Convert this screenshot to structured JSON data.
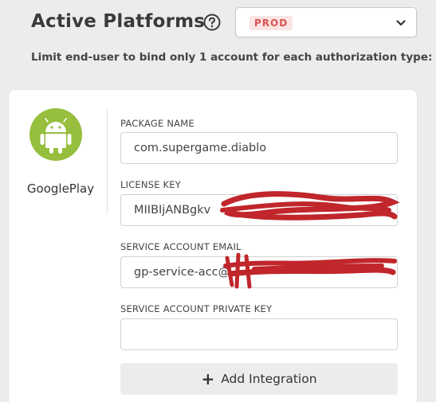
{
  "header": {
    "title": "Active Platforms",
    "help_icon": "help-circle-icon",
    "environment": {
      "selected": "PROD",
      "badge_bg": "#fbe4e4",
      "badge_color": "#d9534f"
    },
    "subtitle": "Limit end-user to bind only 1 account for each authorization type:"
  },
  "platform": {
    "name": "GooglePlay",
    "icon": "android-icon",
    "brand_color": "#95bf3c",
    "fields": [
      {
        "label": "PACKAGE NAME",
        "value": "com.supergame.diablo"
      },
      {
        "label": "LICENSE KEY",
        "value": "MIIBIjANBgkv"
      },
      {
        "label": "SERVICE ACCOUNT EMAIL",
        "value": "gp-service-acc@"
      },
      {
        "label": "SERVICE ACCOUNT PRIVATE KEY",
        "value": ""
      }
    ]
  },
  "actions": {
    "add_label": "Add Integration",
    "add_icon": "plus-icon"
  }
}
